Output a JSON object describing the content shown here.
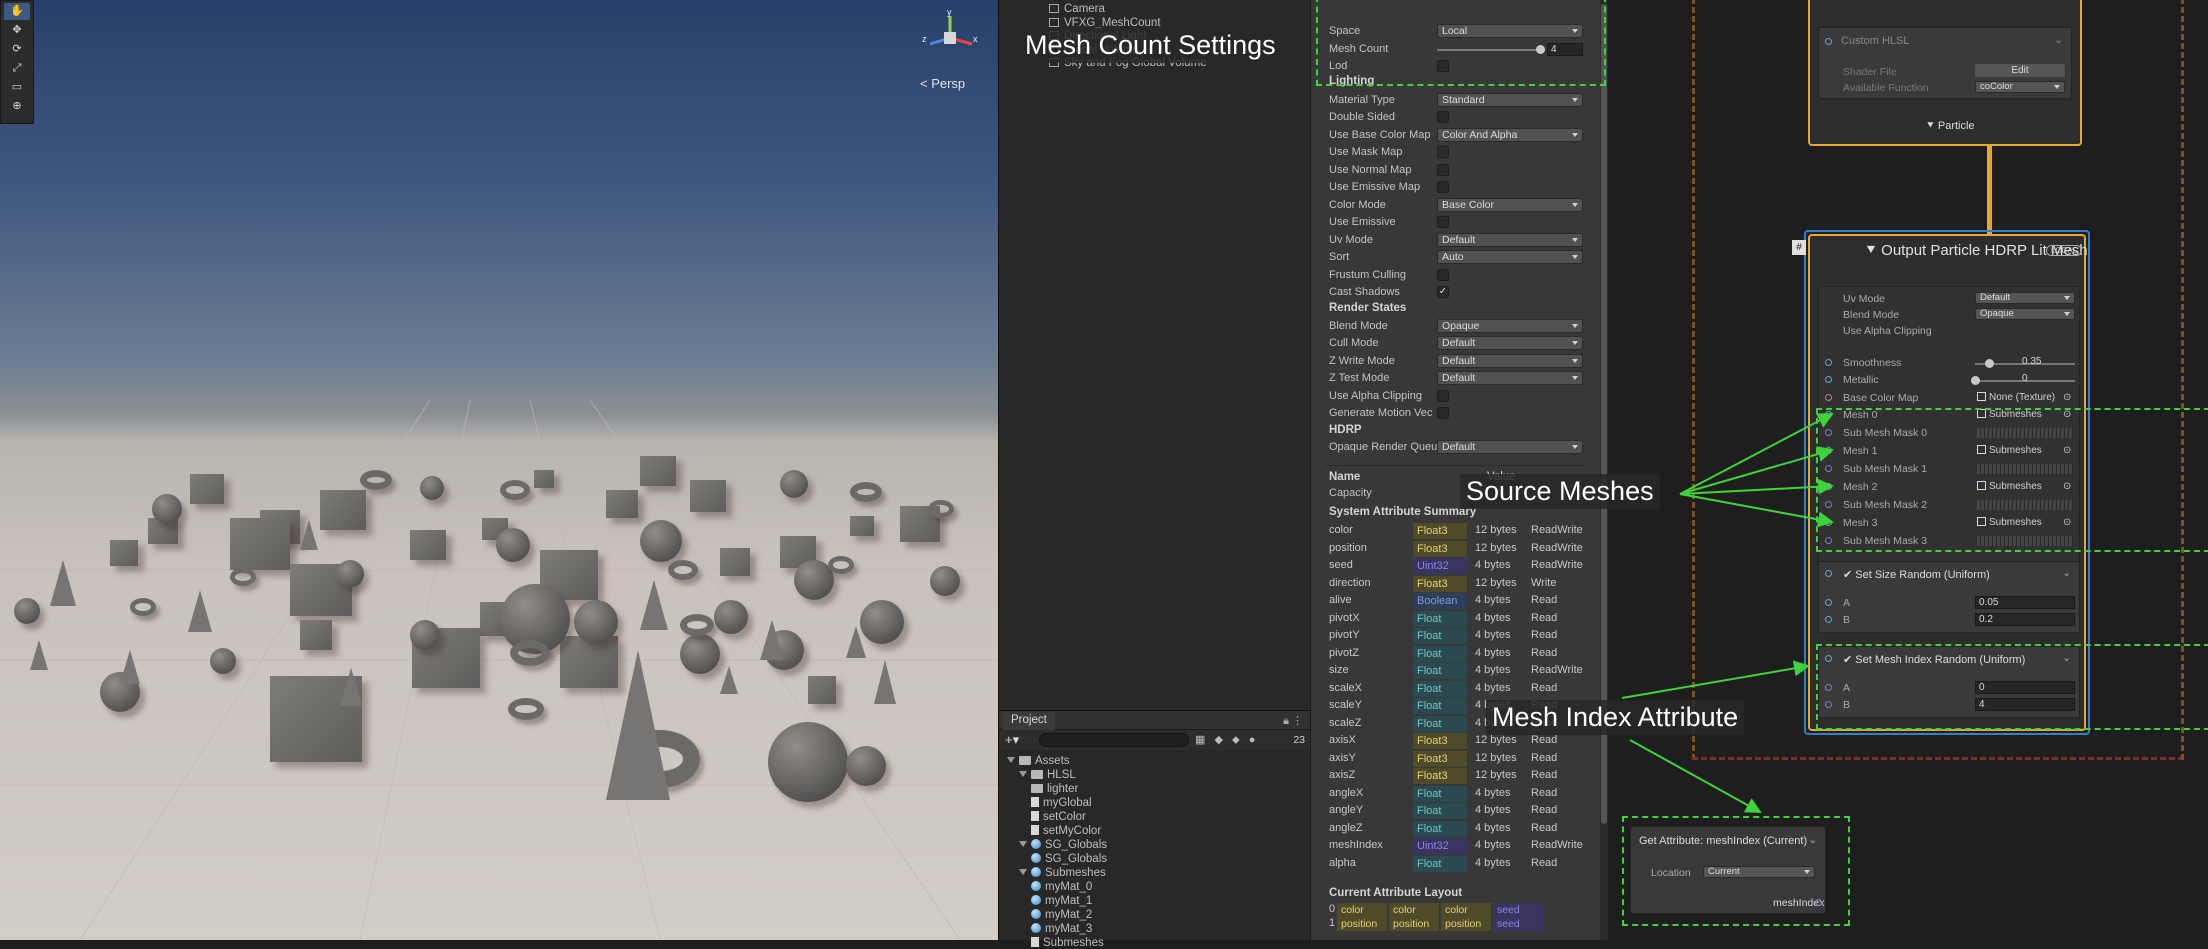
{
  "scene": {
    "tools": [
      "✋",
      "✥",
      "⟳",
      "⤢",
      "▭",
      "⊕"
    ],
    "gizmo_axes": {
      "y": "y",
      "z": "z",
      "x": "x"
    },
    "view_mode": "< Persp"
  },
  "hierarchy": {
    "items": [
      "Camera",
      "VFXG_MeshCount",
      "Directional Light",
      "Global Volume",
      "Sky and Fog Global Volume"
    ]
  },
  "inspector": {
    "top_rows": [
      {
        "label": "Space",
        "type": "dropdown",
        "value": "Local"
      },
      {
        "label": "Mesh Count",
        "type": "slider",
        "value": "4"
      },
      {
        "label": "Lod",
        "type": "check",
        "value": ""
      }
    ],
    "lighting_header": "Lighting",
    "lighting_rows": [
      {
        "label": "Material Type",
        "type": "dropdown",
        "value": "Standard"
      },
      {
        "label": "Double Sided",
        "type": "check",
        "value": ""
      },
      {
        "label": "Use Base Color Map",
        "type": "dropdown",
        "value": "Color And Alpha"
      },
      {
        "label": "Use Mask Map",
        "type": "check",
        "value": ""
      },
      {
        "label": "Use Normal Map",
        "type": "check",
        "value": ""
      },
      {
        "label": "Use Emissive Map",
        "type": "check",
        "value": ""
      },
      {
        "label": "Color Mode",
        "type": "dropdown",
        "value": "Base Color"
      },
      {
        "label": "Use Emissive",
        "type": "check",
        "value": ""
      },
      {
        "label": "Uv Mode",
        "type": "dropdown",
        "value": "Default"
      },
      {
        "label": "Sort",
        "type": "dropdown",
        "value": "Auto"
      },
      {
        "label": "Frustum Culling",
        "type": "check",
        "value": ""
      },
      {
        "label": "Cast Shadows",
        "type": "check",
        "value": "✓"
      }
    ],
    "render_header": "Render States",
    "render_rows": [
      {
        "label": "Blend Mode",
        "type": "dropdown",
        "value": "Opaque"
      },
      {
        "label": "Cull Mode",
        "type": "dropdown",
        "value": "Default"
      },
      {
        "label": "Z Write Mode",
        "type": "dropdown",
        "value": "Default"
      },
      {
        "label": "Z Test Mode",
        "type": "dropdown",
        "value": "Default"
      },
      {
        "label": "Use Alpha Clipping",
        "type": "check",
        "value": ""
      },
      {
        "label": "Generate Motion Vec",
        "type": "check",
        "value": ""
      }
    ],
    "hdrp_header": "HDRP",
    "hdrp_rows": [
      {
        "label": "Opaque Render Queu",
        "type": "dropdown",
        "value": "Default"
      }
    ],
    "name_col": "Name",
    "value_col": "Value",
    "capacity_label": "Capacity",
    "system_attr_header": "System Attribute Summary",
    "attributes": [
      {
        "name": "color",
        "type": "Float3",
        "size": "12 bytes",
        "access": "ReadWrite"
      },
      {
        "name": "position",
        "type": "Float3",
        "size": "12 bytes",
        "access": "ReadWrite"
      },
      {
        "name": "seed",
        "type": "Uint32",
        "size": "4 bytes",
        "access": "ReadWrite"
      },
      {
        "name": "direction",
        "type": "Float3",
        "size": "12 bytes",
        "access": "Write"
      },
      {
        "name": "alive",
        "type": "Boolean",
        "size": "4 bytes",
        "access": "Read"
      },
      {
        "name": "pivotX",
        "type": "Float",
        "size": "4 bytes",
        "access": "Read"
      },
      {
        "name": "pivotY",
        "type": "Float",
        "size": "4 bytes",
        "access": "Read"
      },
      {
        "name": "pivotZ",
        "type": "Float",
        "size": "4 bytes",
        "access": "Read"
      },
      {
        "name": "size",
        "type": "Float",
        "size": "4 bytes",
        "access": "ReadWrite"
      },
      {
        "name": "scaleX",
        "type": "Float",
        "size": "4 bytes",
        "access": "Read"
      },
      {
        "name": "scaleY",
        "type": "Float",
        "size": "4 bytes",
        "access": "Read"
      },
      {
        "name": "scaleZ",
        "type": "Float",
        "size": "4 bytes",
        "access": "Read"
      },
      {
        "name": "axisX",
        "type": "Float3",
        "size": "12 bytes",
        "access": "Read"
      },
      {
        "name": "axisY",
        "type": "Float3",
        "size": "12 bytes",
        "access": "Read"
      },
      {
        "name": "axisZ",
        "type": "Float3",
        "size": "12 bytes",
        "access": "Read"
      },
      {
        "name": "angleX",
        "type": "Float",
        "size": "4 bytes",
        "access": "Read"
      },
      {
        "name": "angleY",
        "type": "Float",
        "size": "4 bytes",
        "access": "Read"
      },
      {
        "name": "angleZ",
        "type": "Float",
        "size": "4 bytes",
        "access": "Read"
      },
      {
        "name": "meshIndex",
        "type": "Uint32",
        "size": "4 bytes",
        "access": "ReadWrite"
      },
      {
        "name": "alpha",
        "type": "Float",
        "size": "4 bytes",
        "access": "Read"
      }
    ],
    "layout_header": "Current Attribute Layout",
    "layout_rows": [
      {
        "index": "0",
        "cells": [
          "color",
          "color",
          "color",
          "seed"
        ]
      },
      {
        "index": "1",
        "cells": [
          "position",
          "position",
          "position",
          "seed"
        ]
      }
    ]
  },
  "project": {
    "tab": "Project",
    "count": "23",
    "items": [
      {
        "label": "Assets",
        "indent": 0,
        "icon": "folder",
        "open": true
      },
      {
        "label": "HLSL",
        "indent": 1,
        "icon": "folder",
        "open": true
      },
      {
        "label": "lighter",
        "indent": 2,
        "icon": "folder",
        "open": false
      },
      {
        "label": "myGlobal",
        "indent": 2,
        "icon": "doc",
        "open": false
      },
      {
        "label": "setColor",
        "indent": 2,
        "icon": "doc",
        "open": false
      },
      {
        "label": "setMyColor",
        "indent": 2,
        "icon": "doc",
        "open": false
      },
      {
        "label": "SG_Globals",
        "indent": 1,
        "icon": "ball",
        "open": true
      },
      {
        "label": "SG_Globals",
        "indent": 2,
        "icon": "ball",
        "open": false
      },
      {
        "label": "Submeshes",
        "indent": 1,
        "icon": "ball",
        "open": true
      },
      {
        "label": "myMat_0",
        "indent": 2,
        "icon": "ball",
        "open": false
      },
      {
        "label": "myMat_1",
        "indent": 2,
        "icon": "ball",
        "open": false
      },
      {
        "label": "myMat_2",
        "indent": 2,
        "icon": "ball",
        "open": false
      },
      {
        "label": "myMat_3",
        "indent": 2,
        "icon": "ball",
        "open": false
      },
      {
        "label": "Submeshes",
        "indent": 2,
        "icon": "grid",
        "open": false
      }
    ]
  },
  "graph": {
    "custom_hlsl": {
      "title": "Custom HLSL",
      "shader_file_label": "Shader File",
      "shader_file_button": "Edit",
      "available_function_label": "Available Function",
      "available_function_value": "coColor"
    },
    "particle_label": "Particle",
    "output": {
      "title": "Output Particle HDRP Lit Mesh",
      "badge": "LOCAL",
      "uv_mode_label": "Uv Mode",
      "uv_mode_value": "Default",
      "blend_mode_label": "Blend Mode",
      "blend_mode_value": "Opaque",
      "alpha_clip_label": "Use Alpha Clipping",
      "smoothness_label": "Smoothness",
      "smoothness_value": "0.35",
      "metallic_label": "Metallic",
      "metallic_value": "0",
      "base_color_map_label": "Base Color Map",
      "base_color_map_value": "None (Texture)",
      "mesh_rows": [
        {
          "label": "Mesh 0",
          "value": "Submeshes",
          "mask_label": "Sub Mesh Mask 0"
        },
        {
          "label": "Mesh 1",
          "value": "Submeshes",
          "mask_label": "Sub Mesh Mask 1"
        },
        {
          "label": "Mesh 2",
          "value": "Submeshes",
          "mask_label": "Sub Mesh Mask 2"
        },
        {
          "label": "Mesh 3",
          "value": "Submeshes",
          "mask_label": "Sub Mesh Mask 3"
        }
      ]
    },
    "size_block": {
      "title": "Set Size Random (Uniform)",
      "a_label": "A",
      "a_value": "0.05",
      "b_label": "B",
      "b_value": "0.2"
    },
    "mesh_index_block": {
      "title": "Set Mesh Index Random (Uniform)",
      "a_label": "A",
      "a_value": "0",
      "b_label": "B",
      "b_value": "4"
    },
    "get_attr": {
      "title": "Get Attribute: meshIndex (Current)",
      "location_label": "Location",
      "location_value": "Current",
      "output_label": "meshIndex"
    }
  },
  "callouts": {
    "mesh_count": "Mesh Count Settings",
    "source_meshes": "Source Meshes",
    "mesh_index": "Mesh Index Attribute"
  },
  "colors": {
    "context_border": "#7c5424",
    "highlight_dash": "#3ed33a",
    "particle_link": "#e8a82a",
    "output_select": "#2f7fd0"
  }
}
